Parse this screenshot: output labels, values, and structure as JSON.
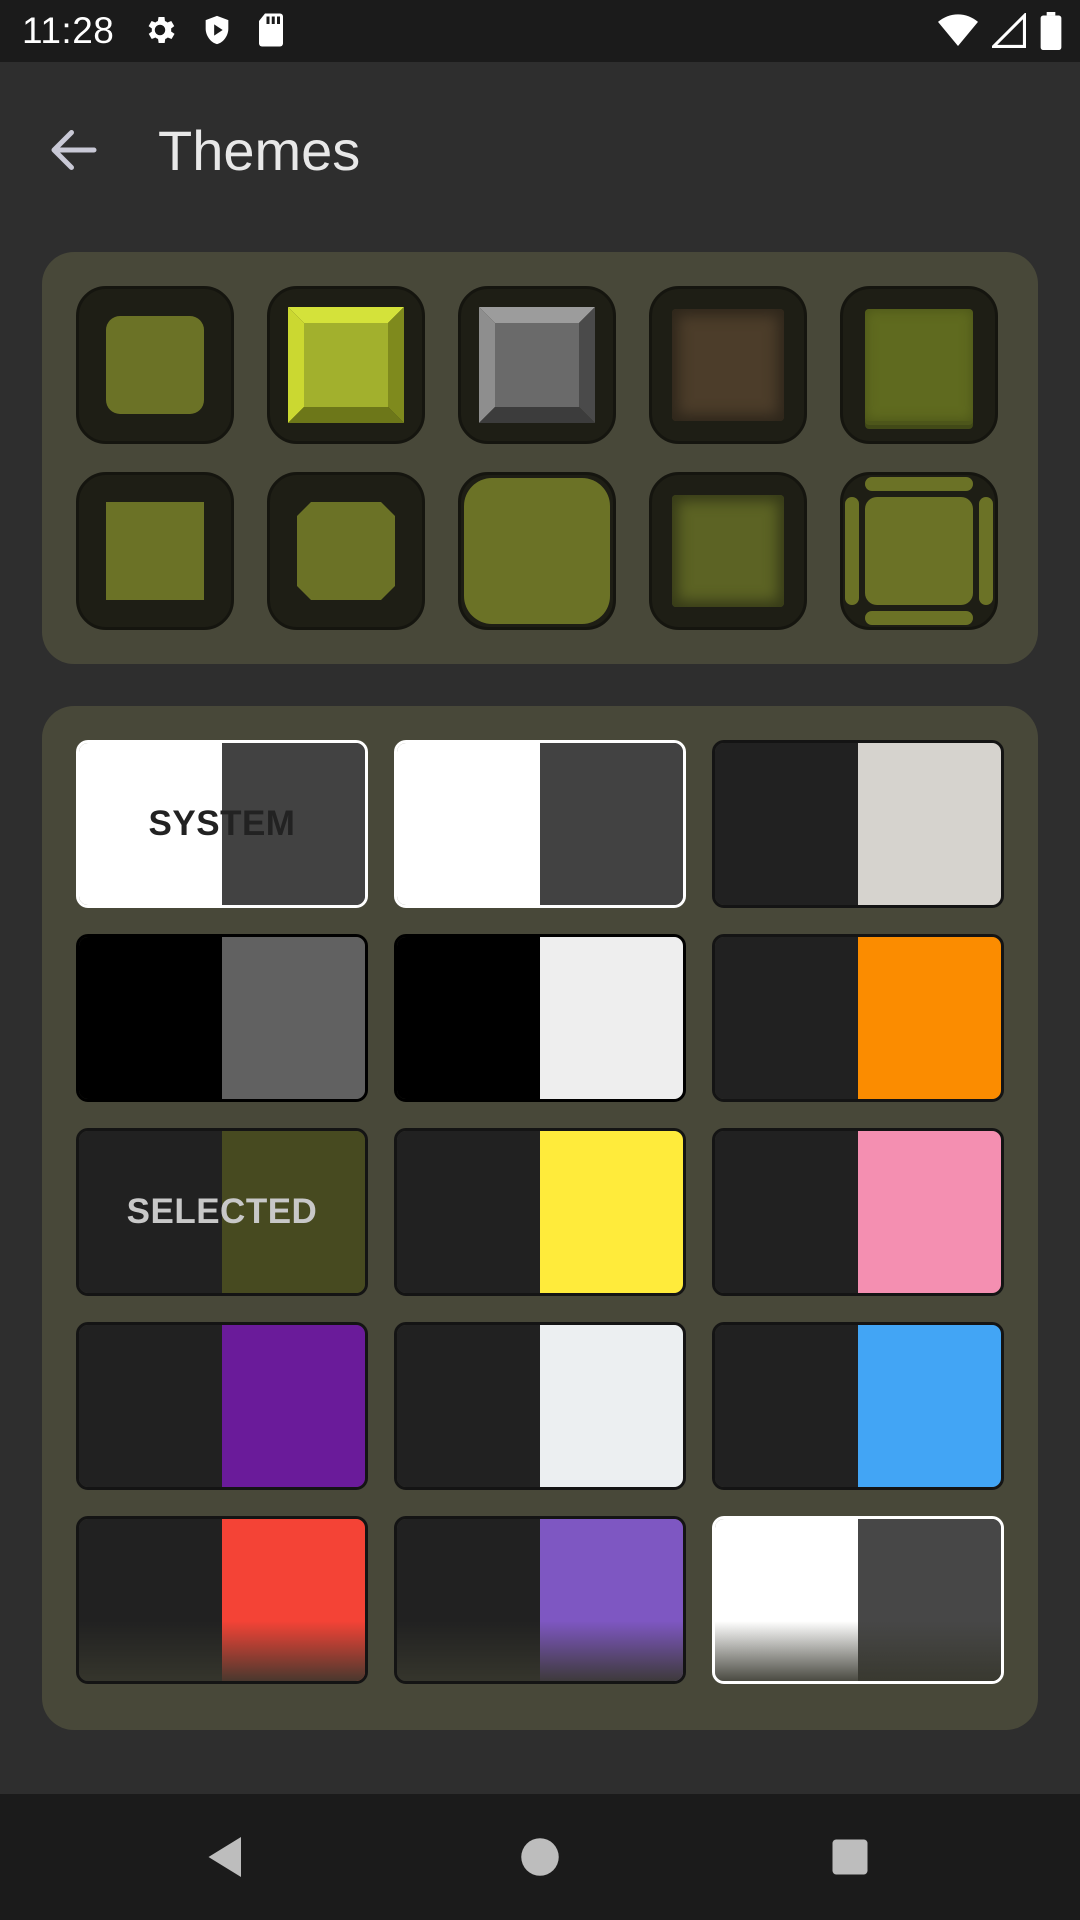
{
  "status_bar": {
    "time": "11:28",
    "left_icons": [
      "gear-icon",
      "shield-icon",
      "sd-card-icon"
    ],
    "right_icons": [
      "wifi-icon",
      "signal-icon",
      "battery-icon"
    ]
  },
  "app_bar": {
    "title": "Themes",
    "back_icon": "arrow-left-icon"
  },
  "style_panel": {
    "tiles": [
      {
        "name": "rounded-flat"
      },
      {
        "name": "bevel-bright"
      },
      {
        "name": "bevel-gray"
      },
      {
        "name": "grunge-brown"
      },
      {
        "name": "stacked-glow"
      },
      {
        "name": "square-flat"
      },
      {
        "name": "octagon"
      },
      {
        "name": "large-rounded"
      },
      {
        "name": "grunge-olive"
      },
      {
        "name": "framed"
      }
    ]
  },
  "theme_panel": {
    "tiles": [
      {
        "label": "SYSTEM",
        "left": "#ffffff",
        "right": "#424242",
        "border": "#ffffff",
        "label_color": "#222222"
      },
      {
        "label": "",
        "left": "#ffffff",
        "right": "#424242",
        "border": "#ffffff"
      },
      {
        "label": "",
        "left": "#212121",
        "right": "#d6d3ce",
        "border": "#141414"
      },
      {
        "label": "",
        "left": "#000000",
        "right": "#616161",
        "border": "#000000"
      },
      {
        "label": "",
        "left": "#000000",
        "right": "#eeeeee",
        "border": "#000000"
      },
      {
        "label": "",
        "left": "#212121",
        "right": "#fb8c00",
        "border": "#141414"
      },
      {
        "label": "SELECTED",
        "left": "#212121",
        "right": "#474a20",
        "border": "#141414",
        "label_color": "#c8c8c8"
      },
      {
        "label": "",
        "left": "#212121",
        "right": "#ffeb3b",
        "border": "#141414"
      },
      {
        "label": "",
        "left": "#212121",
        "right": "#f48fb1",
        "border": "#141414"
      },
      {
        "label": "",
        "left": "#212121",
        "right": "#6a1b9a",
        "border": "#141414"
      },
      {
        "label": "",
        "left": "#212121",
        "right": "#eceff1",
        "border": "#141414"
      },
      {
        "label": "",
        "left": "#212121",
        "right": "#42a5f5",
        "border": "#141414"
      },
      {
        "label": "",
        "left": "#212121",
        "right": "#f44336",
        "border": "#141414"
      },
      {
        "label": "",
        "left": "#212121",
        "right": "#7e57c2",
        "border": "#141414"
      },
      {
        "label": "",
        "left": "#ffffff",
        "right": "#474747",
        "border": "#ffffff"
      }
    ]
  },
  "nav_bar": {
    "buttons": [
      "back-triangle-icon",
      "home-circle-icon",
      "recents-square-icon"
    ]
  },
  "colors": {
    "accent_olive": "#6b7226",
    "panel": "#484839",
    "background": "#2e2e2e"
  }
}
